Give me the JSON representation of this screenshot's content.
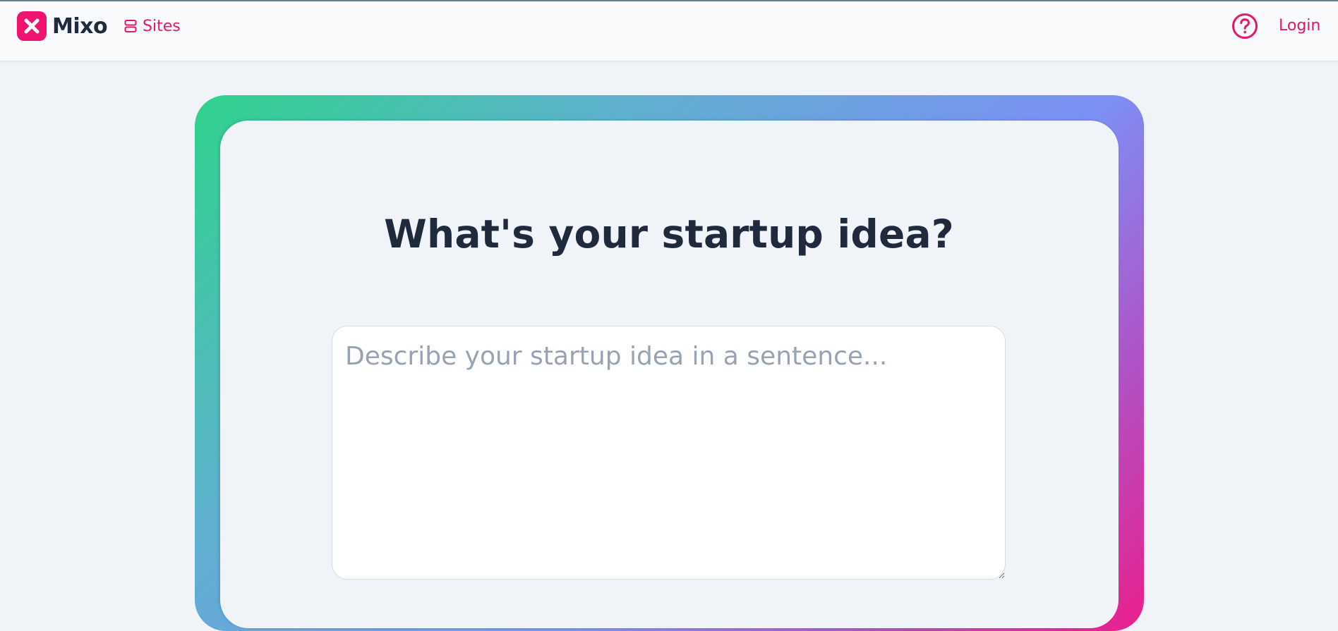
{
  "header": {
    "brand_name": "Mixo",
    "brand_logo_icon": "x-mark-icon",
    "nav_sites_label": "Sites",
    "nav_sites_icon": "stacked-layers-icon",
    "help_icon": "question-circle-icon",
    "login_label": "Login"
  },
  "main": {
    "headline": "What's your startup idea?",
    "idea_input": {
      "value": "",
      "placeholder": "Describe your startup idea in a sentence..."
    }
  },
  "colors": {
    "brand_pink": "#e5166f",
    "heading_text": "#1f2a3d",
    "page_background": "#f0f3f8",
    "gradient_start": "#2fd38c",
    "gradient_mid": "#7c8ff5",
    "gradient_end": "#eb1f8b"
  }
}
